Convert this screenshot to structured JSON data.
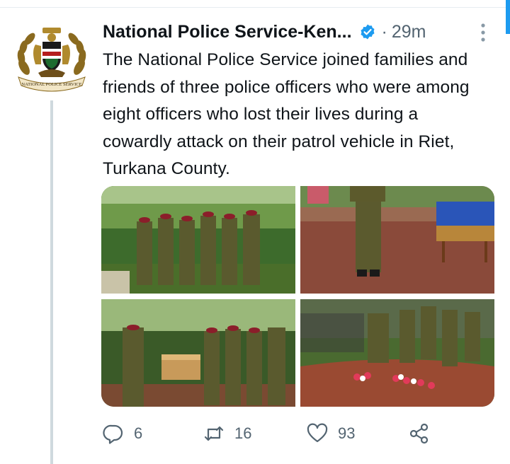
{
  "tweet": {
    "author_name": "National Police Service-Ken...",
    "separator": "·",
    "time": "29m",
    "text": "The National Police Service joined families and friends of three police officers who were among eight officers who lost their lives during a cowardly attack on their patrol vehicle in Riet, Turkana County.",
    "verified": true,
    "avatar_text": "NATIONAL POLICE SERVICE",
    "media": [
      {
        "description": "officers-in-formation"
      },
      {
        "description": "officer-standing-by-coffin"
      },
      {
        "description": "officers-carrying-coffin"
      },
      {
        "description": "grave-with-flowers"
      }
    ]
  },
  "actions": {
    "reply_count": "6",
    "retweet_count": "16",
    "like_count": "93"
  },
  "colors": {
    "accent": "#1d9bf0",
    "text": "#0f1419",
    "muted": "#536471"
  },
  "icons": [
    "verified-badge-icon",
    "more-options-icon",
    "reply-icon",
    "retweet-icon",
    "like-icon",
    "share-icon"
  ]
}
